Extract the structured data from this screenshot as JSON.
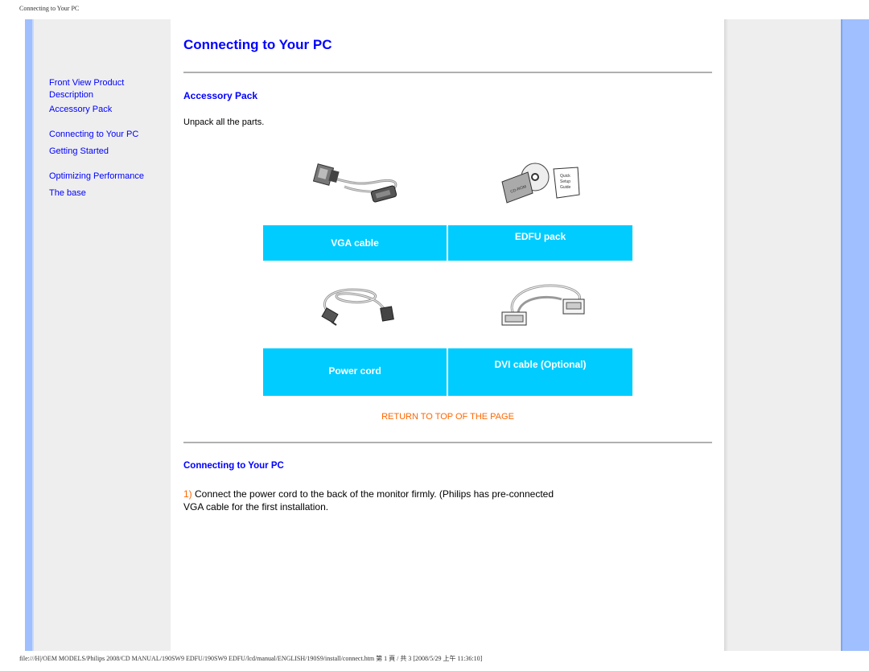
{
  "print_header": "Connecting to Your PC",
  "print_footer": "file:///H|/OEM MODELS/Philips 2008/CD MANUAL/190SW9 EDFU/190SW9 EDFU/lcd/manual/ENGLISH/190S9/install/connect.htm 第 1 頁 / 共 3 [2008/5/29 上午 11:36:10]",
  "sidebar": {
    "items": [
      {
        "label": "Front View Product Description"
      },
      {
        "label": "Accessory Pack"
      },
      {
        "label": "Connecting to Your PC"
      },
      {
        "label": "Getting Started"
      },
      {
        "label": "Optimizing Performance"
      },
      {
        "label": "The base"
      }
    ]
  },
  "main": {
    "title": "Connecting to Your PC",
    "accessory_section": {
      "heading": "Accessory Pack",
      "intro": "Unpack all the parts.",
      "items": [
        {
          "label": "VGA cable",
          "icon": "vga-cable-icon"
        },
        {
          "label": "EDFU pack",
          "icon": "edfu-pack-icon"
        },
        {
          "label": "Power cord",
          "icon": "power-cord-icon"
        },
        {
          "label": "DVI cable (Optional)",
          "icon": "dvi-cable-icon"
        }
      ]
    },
    "return_link": "RETURN TO TOP OF THE PAGE",
    "connect_section": {
      "heading": "Connecting to Your PC",
      "step_number": "1)",
      "step_text": " Connect the power cord to the back of the monitor firmly. (Philips has pre-connected VGA cable for the first installation."
    }
  },
  "colors": {
    "link": "#0000ff",
    "accent_orange": "#ff6600",
    "label_bg": "#00ccff",
    "frame_blue": "#9fbfff",
    "panel_gray": "#eeeeee"
  }
}
